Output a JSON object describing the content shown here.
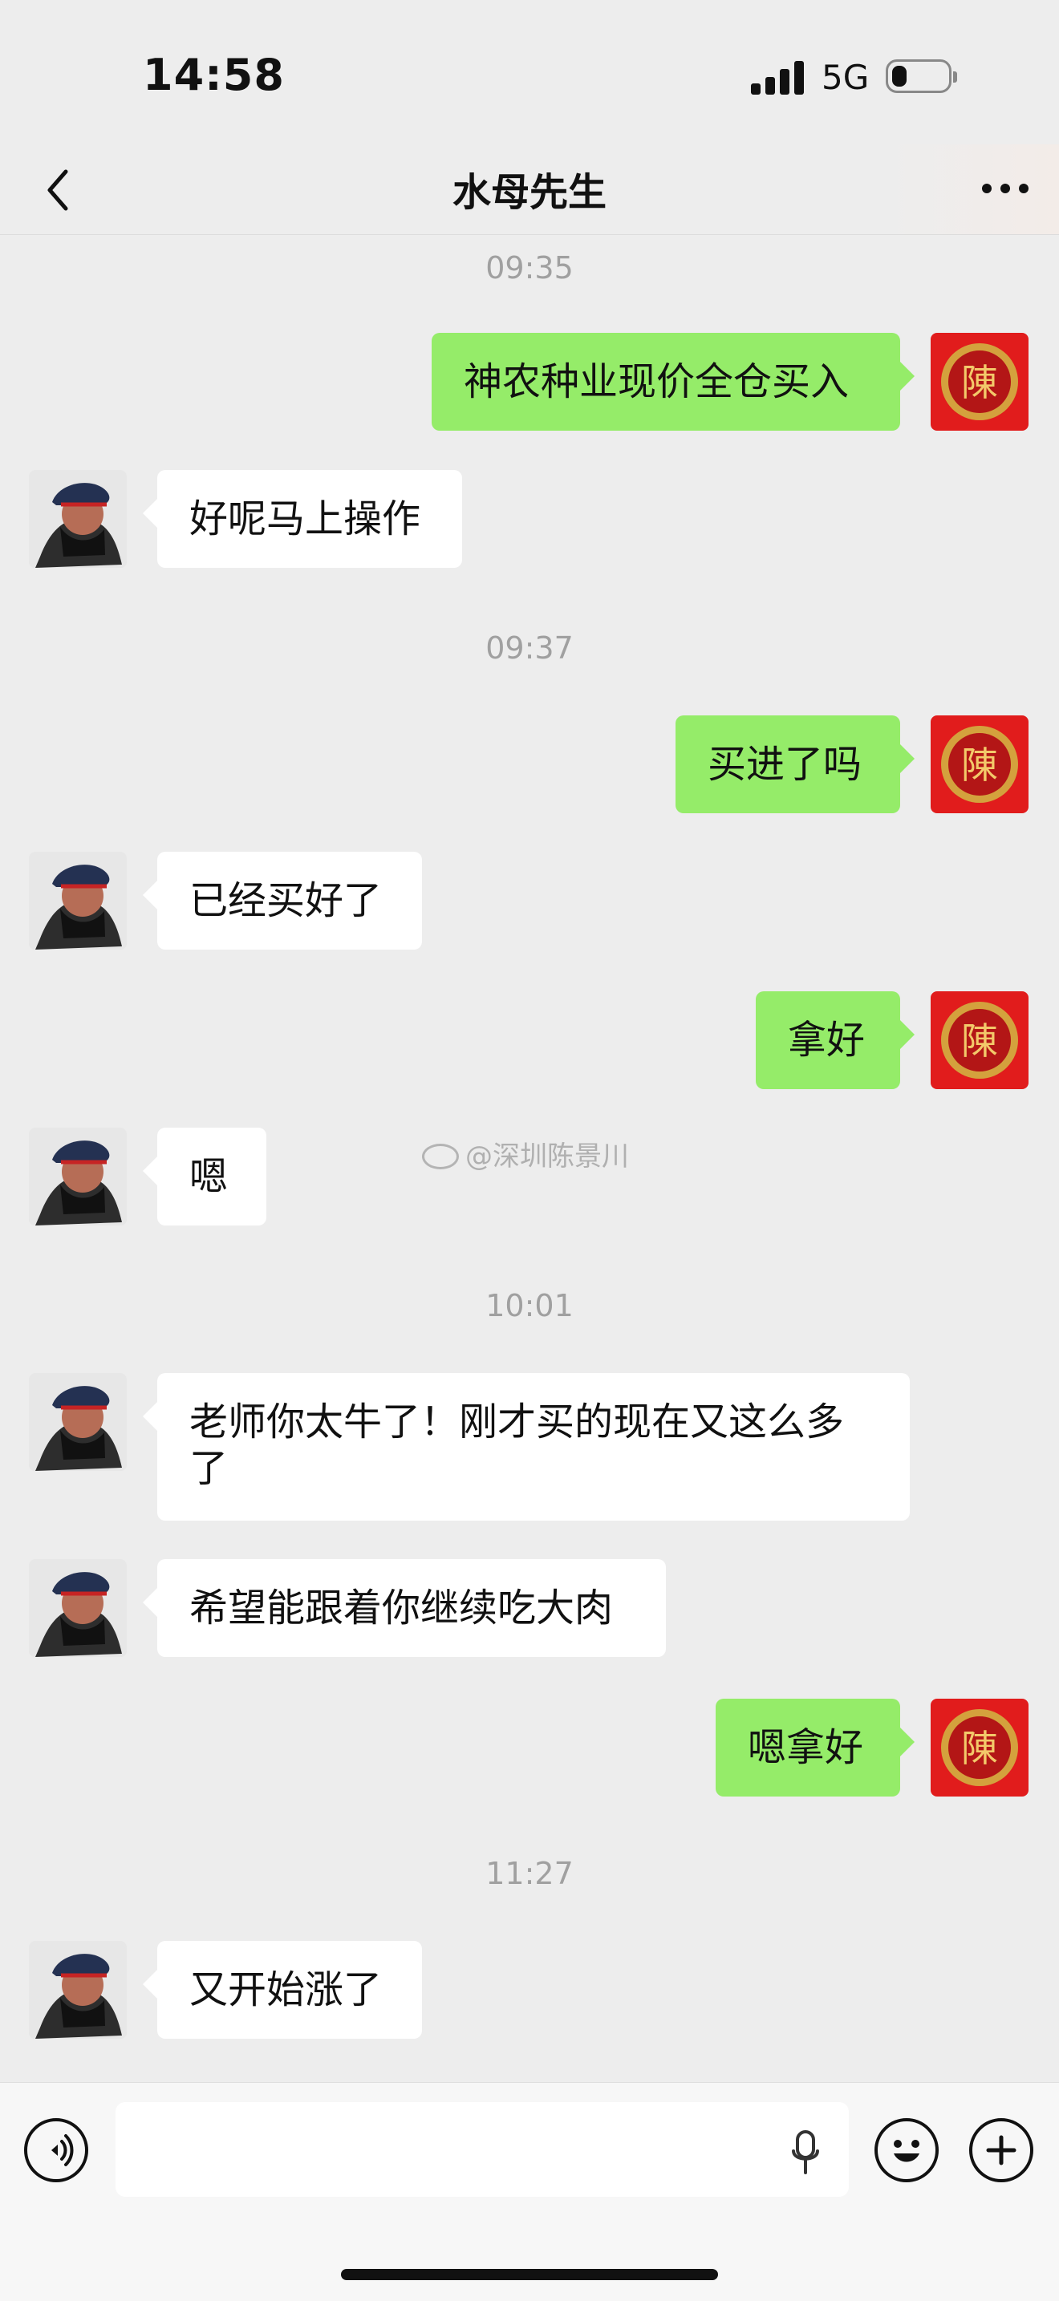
{
  "status_bar": {
    "time": "14:58",
    "network": "5G",
    "battery_level": 0.28
  },
  "header": {
    "title": "水母先生",
    "back_icon": "chevron-left-icon",
    "more_icon": "more-horizontal-icon"
  },
  "watermark": {
    "text": "@深圳陈景川"
  },
  "messages": [
    {
      "type": "timestamp",
      "text": "09:35"
    },
    {
      "type": "message",
      "side": "right",
      "text": "神农种业现价全仓买入"
    },
    {
      "type": "message",
      "side": "left",
      "text": "好呢马上操作"
    },
    {
      "type": "timestamp",
      "text": "09:37"
    },
    {
      "type": "message",
      "side": "right",
      "text": "买进了吗"
    },
    {
      "type": "message",
      "side": "left",
      "text": "已经买好了"
    },
    {
      "type": "message",
      "side": "right",
      "text": "拿好"
    },
    {
      "type": "message",
      "side": "left",
      "text": "嗯"
    },
    {
      "type": "timestamp",
      "text": "10:01"
    },
    {
      "type": "message",
      "side": "left",
      "text": "老师你太牛了！刚才买的现在又这么多了"
    },
    {
      "type": "message",
      "side": "left",
      "text": "希望能跟着你继续吃大肉"
    },
    {
      "type": "message",
      "side": "right",
      "text": "嗯拿好"
    },
    {
      "type": "timestamp",
      "text": "11:27"
    },
    {
      "type": "message",
      "side": "left",
      "text": "又开始涨了"
    }
  ],
  "input_bar": {
    "placeholder": "",
    "voice_icon": "voice-mode-icon",
    "mic_icon": "microphone-icon",
    "emoji_icon": "emoji-icon",
    "plus_icon": "plus-icon"
  },
  "colors": {
    "chat_background": "#ededed",
    "sent_bubble": "#95ec69",
    "received_bubble": "#ffffff",
    "timestamp": "#a0a0a0"
  }
}
